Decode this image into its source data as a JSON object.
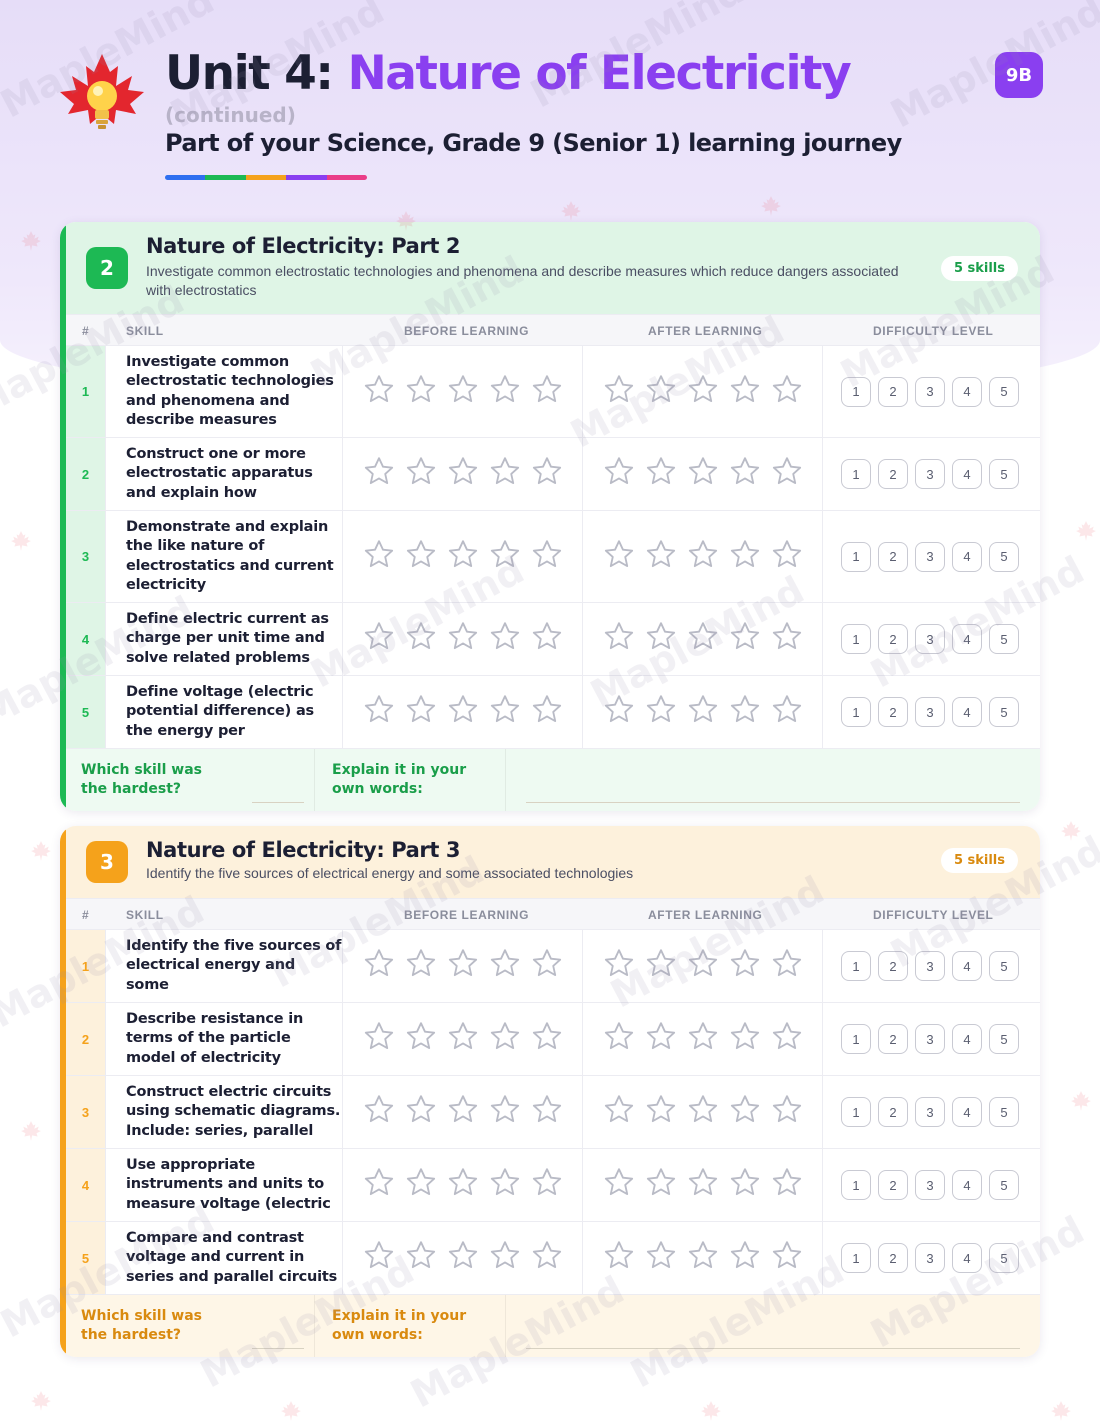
{
  "header": {
    "title_prefix": "Unit 4: ",
    "title_main": "Nature of Electricity",
    "subtitle": "(continued)",
    "tagline": "Part of your Science, Grade 9 (Senior 1) learning journey",
    "badge": "9B"
  },
  "watermark_text": "MapleMind",
  "columns": {
    "num": "#",
    "skill": "SKILL",
    "before": "BEFORE LEARNING",
    "after": "AFTER LEARNING",
    "difficulty": "DIFFICULTY LEVEL"
  },
  "difficulty_levels": [
    "1",
    "2",
    "3",
    "4",
    "5"
  ],
  "sections": [
    {
      "number": "2",
      "title": "Nature of Electricity: Part 2",
      "description": "Investigate common electrostatic technologies and phenomena and describe measures which reduce dangers associated with electrostatics",
      "skills_count": "5 skills",
      "accent": "#1db954",
      "head_bg": "#dff5e6",
      "foot_bg": "#eefaf2",
      "skills": [
        {
          "num": "1",
          "text": "Investigate common electrostatic technologies and phenomena and describe measures"
        },
        {
          "num": "2",
          "text": "Construct one or more electrostatic apparatus and explain how"
        },
        {
          "num": "3",
          "text": "Demonstrate and explain the like nature of electrostatics and current electricity"
        },
        {
          "num": "4",
          "text": "Define electric current as charge per unit time and solve related problems"
        },
        {
          "num": "5",
          "text": "Define voltage (electric potential difference) as the energy per"
        }
      ],
      "footer": {
        "hardest_label": "Which skill was the hardest?",
        "explain_label": "Explain it in your own words:"
      }
    },
    {
      "number": "3",
      "title": "Nature of Electricity: Part 3",
      "description": "Identify the five sources of electrical energy and some associated technologies",
      "skills_count": "5 skills",
      "accent": "#f5a21b",
      "head_bg": "#fdf1dc",
      "foot_bg": "#fef6e7",
      "skills": [
        {
          "num": "1",
          "text": "Identify the five sources of electrical energy and some"
        },
        {
          "num": "2",
          "text": "Describe resistance in terms of the particle model of electricity"
        },
        {
          "num": "3",
          "text": "Construct electric circuits using schematic diagrams. Include: series, parallel"
        },
        {
          "num": "4",
          "text": "Use appropriate instruments and units to measure voltage (electric"
        },
        {
          "num": "5",
          "text": "Compare and contrast voltage and current in series and parallel circuits"
        }
      ],
      "footer": {
        "hardest_label": "Which skill was the hardest?",
        "explain_label": "Explain it in your own words:"
      }
    }
  ]
}
